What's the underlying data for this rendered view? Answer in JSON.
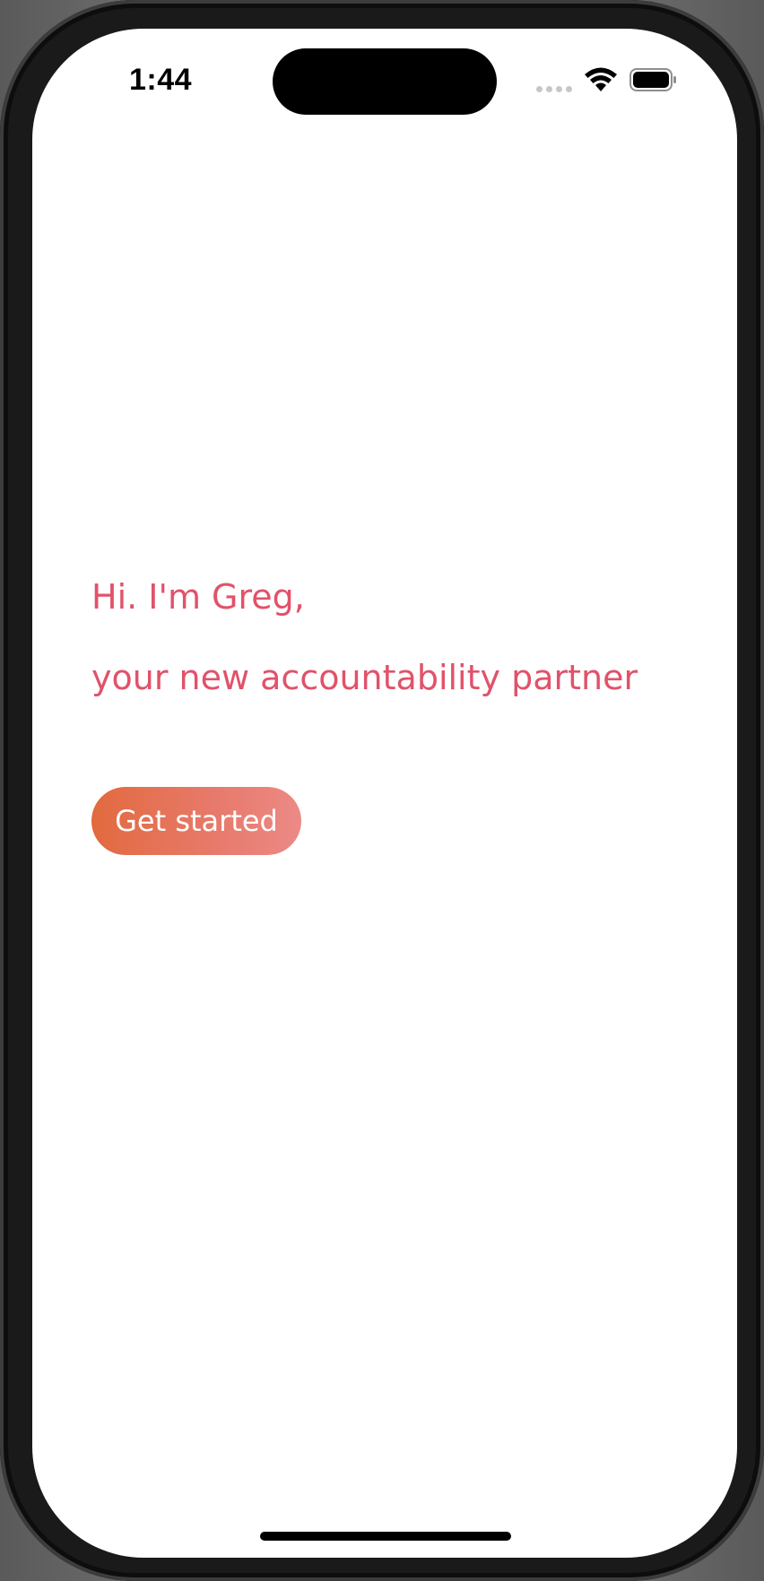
{
  "status_bar": {
    "time": "1:44"
  },
  "icons": {
    "signal": "cellular-signal-icon",
    "wifi": "wifi-icon",
    "battery": "battery-icon"
  },
  "greeting": {
    "line1": "Hi. I'm Greg,",
    "line2": "your new accountability partner"
  },
  "actions": {
    "get_started_label": "Get started"
  },
  "colors": {
    "accent_text": "#e1526a",
    "button_gradient_start": "#e26a3e",
    "button_gradient_end": "#ec8a86",
    "screen_background": "#ffffff"
  }
}
